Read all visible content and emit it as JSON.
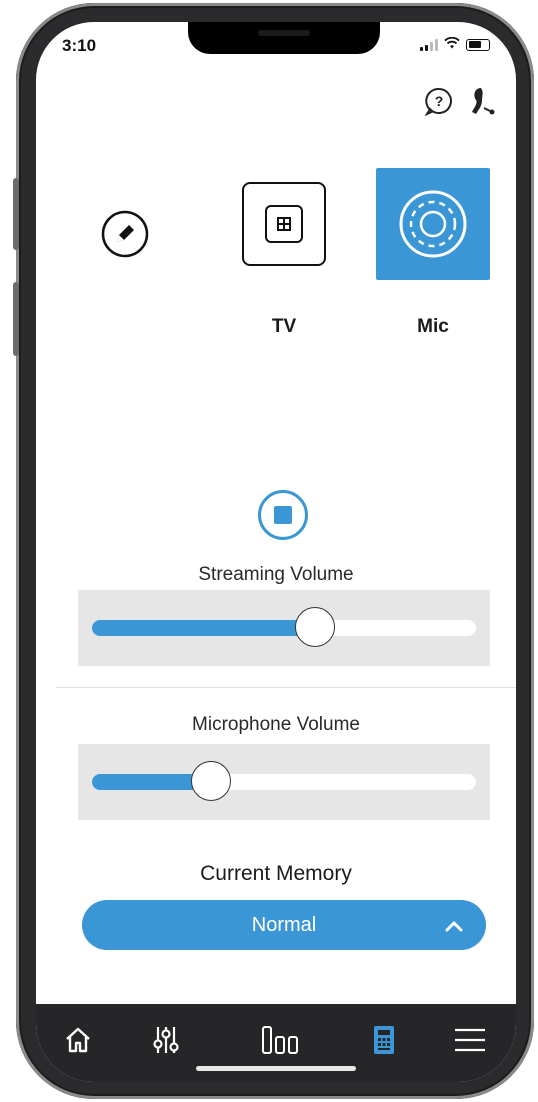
{
  "status": {
    "time": "3:10"
  },
  "sources": [
    {
      "id": "edit",
      "label": ""
    },
    {
      "id": "tv",
      "label": "TV"
    },
    {
      "id": "mic",
      "label": "Mic",
      "selected": true
    }
  ],
  "streaming": {
    "label": "Streaming Volume",
    "level": 0.58
  },
  "microphone": {
    "label": "Microphone Volume",
    "level": 0.31
  },
  "memory": {
    "label": "Current Memory",
    "value": "Normal"
  },
  "icons": {
    "help": "help-icon",
    "hearing_aid": "hearing-aid-icon",
    "edit": "pencil-icon",
    "tv": "tv-icon",
    "mic": "mic-icon",
    "stop": "stop-icon",
    "chevron": "chevron-up-icon",
    "home": "home-icon",
    "adjust": "sliders-icon",
    "programs": "bars-icon",
    "remote": "remote-icon",
    "menu": "menu-icon"
  },
  "colors": {
    "accent": "#3b96d6",
    "tabbar": "#262628"
  },
  "tabbar": {
    "active": "remote"
  }
}
